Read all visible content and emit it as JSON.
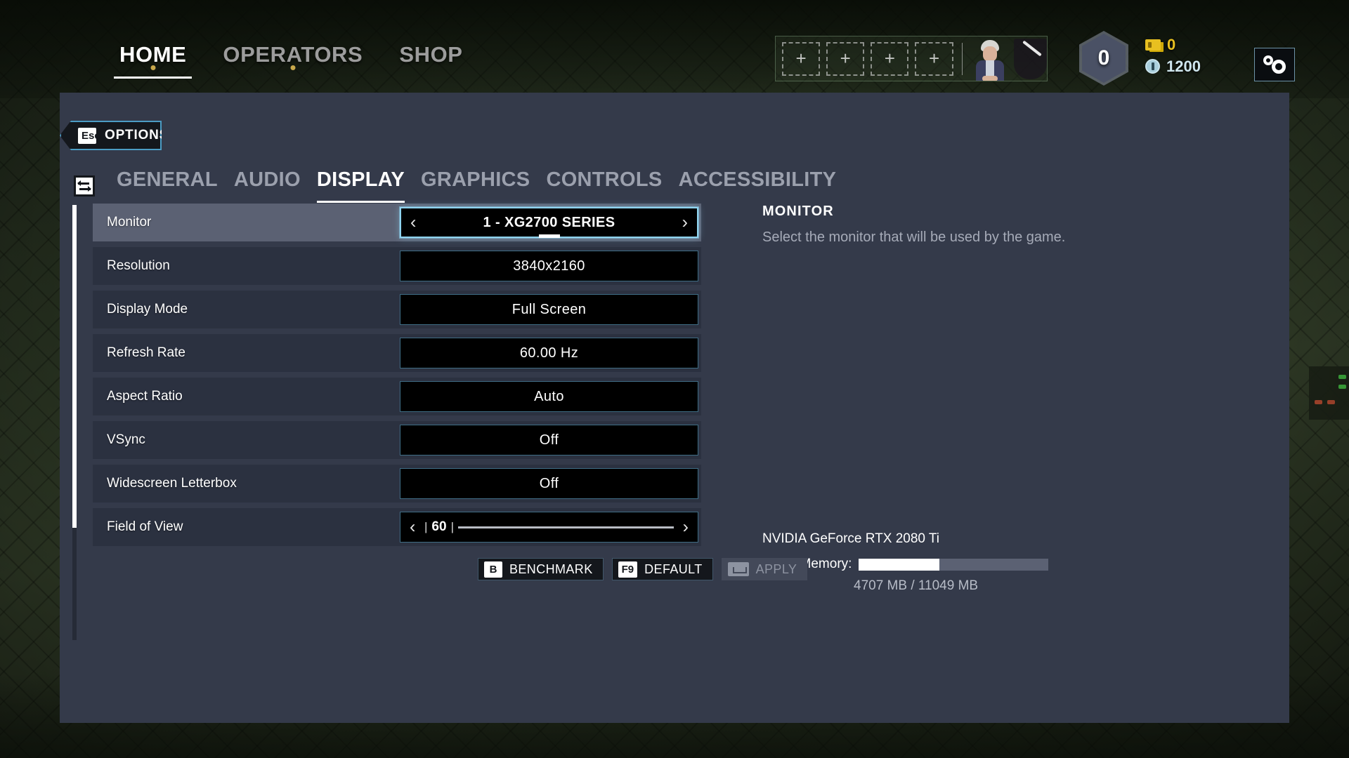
{
  "topnav": {
    "items": [
      {
        "label": "HOME",
        "active": true,
        "dot": true
      },
      {
        "label": "OPERATORS",
        "active": false,
        "dot": true
      },
      {
        "label": "SHOP",
        "active": false,
        "dot": false
      }
    ]
  },
  "hud": {
    "slot_glyph": "+",
    "slots": [
      "+",
      "+",
      "+",
      "+"
    ],
    "level": "0",
    "ticket_value": "0",
    "credit_value": "1200",
    "settings_icon": "gear-icon"
  },
  "panel": {
    "back": {
      "key": "Esc",
      "label": "OPTIONS"
    },
    "tab_icon": "tab-switch-icon",
    "tabs": [
      {
        "label": "GENERAL",
        "active": false
      },
      {
        "label": "AUDIO",
        "active": false
      },
      {
        "label": "DISPLAY",
        "active": true
      },
      {
        "label": "GRAPHICS",
        "active": false
      },
      {
        "label": "CONTROLS",
        "active": false
      },
      {
        "label": "ACCESSIBILITY",
        "active": false
      }
    ]
  },
  "settings": [
    {
      "name": "Monitor",
      "value": "1 - XG2700 SERIES",
      "type": "stepper",
      "selected": true,
      "arrows": true,
      "bold": true
    },
    {
      "name": "Resolution",
      "value": "3840x2160",
      "type": "value",
      "selected": false,
      "arrows": false,
      "bold": false
    },
    {
      "name": "Display Mode",
      "value": "Full Screen",
      "type": "value",
      "selected": false,
      "arrows": false,
      "bold": false
    },
    {
      "name": "Refresh Rate",
      "value": "60.00 Hz",
      "type": "value",
      "selected": false,
      "arrows": false,
      "bold": false
    },
    {
      "name": "Aspect Ratio",
      "value": "Auto",
      "type": "value",
      "selected": false,
      "arrows": false,
      "bold": false
    },
    {
      "name": "VSync",
      "value": "Off",
      "type": "value",
      "selected": false,
      "arrows": false,
      "bold": false
    },
    {
      "name": "Widescreen Letterbox",
      "value": "Off",
      "type": "value",
      "selected": false,
      "arrows": false,
      "bold": false
    },
    {
      "name": "Field of View",
      "value": "60",
      "type": "slider",
      "selected": false,
      "arrows": true,
      "bold": false,
      "fill_percent": 0
    }
  ],
  "info": {
    "title": "MONITOR",
    "description": "Select the monitor that will be used by the game."
  },
  "gpu": {
    "name": "NVIDIA GeForce RTX 2080 Ti",
    "vram_label": "Video Memory:",
    "vram_used_mb": 4707,
    "vram_total_mb": 11049,
    "vram_text": "4707 MB / 11049 MB",
    "vram_percent": 42.6
  },
  "buttons": [
    {
      "key": "B",
      "label": "BENCHMARK",
      "disabled": false,
      "icon": "key-b"
    },
    {
      "key": "F9",
      "label": "DEFAULT",
      "disabled": false,
      "icon": "key-f9"
    },
    {
      "key": "",
      "label": "APPLY",
      "disabled": true,
      "icon": "spacebar-icon"
    }
  ],
  "colors": {
    "accent_blue": "#8fd3ef",
    "panel_bg": "#343a4a",
    "row_bg": "#2b3140",
    "row_selected_bg": "#5b6173",
    "ticket_yellow": "#e8c020",
    "credit_blue": "#cfe6ee"
  }
}
